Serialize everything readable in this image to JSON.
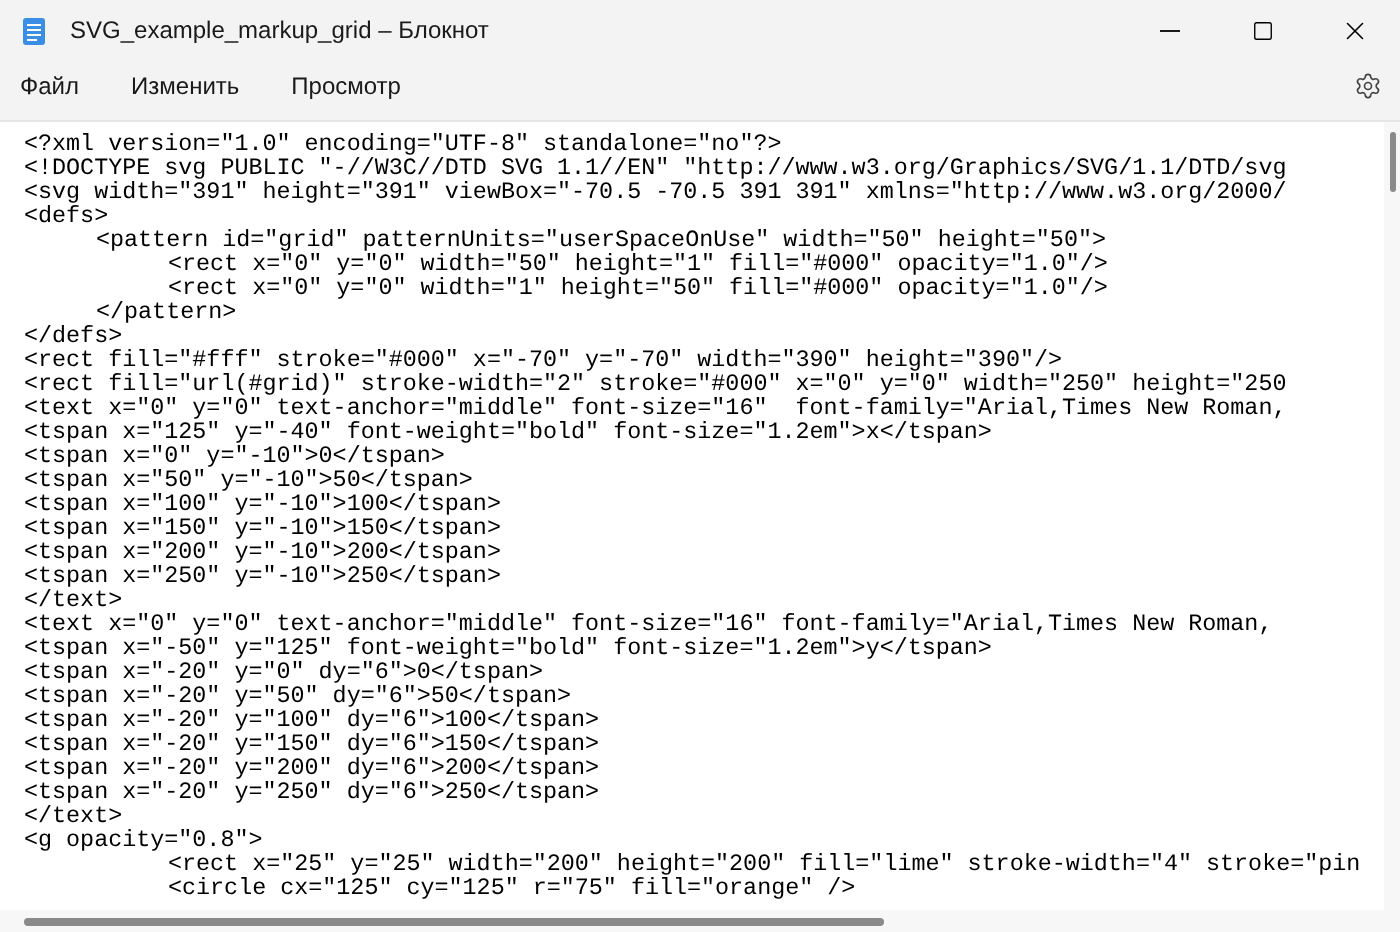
{
  "window": {
    "title": "SVG_example_markup_grid – Блокнот"
  },
  "menu": [
    "Файл",
    "Изменить",
    "Просмотр"
  ],
  "editor": {
    "lines": [
      "<?xml version=\"1.0\" encoding=\"UTF-8\" standalone=\"no\"?>",
      "<!DOCTYPE svg PUBLIC \"-//W3C//DTD SVG 1.1//EN\" \"http://www.w3.org/Graphics/SVG/1.1/DTD/svg",
      "<svg width=\"391\" height=\"391\" viewBox=\"-70.5 -70.5 391 391\" xmlns=\"http://www.w3.org/2000/",
      "<defs>",
      "\t<pattern id=\"grid\" patternUnits=\"userSpaceOnUse\" width=\"50\" height=\"50\">",
      "\t\t<rect x=\"0\" y=\"0\" width=\"50\" height=\"1\" fill=\"#000\" opacity=\"1.0\"/>",
      "\t\t<rect x=\"0\" y=\"0\" width=\"1\" height=\"50\" fill=\"#000\" opacity=\"1.0\"/>",
      "\t</pattern>",
      "</defs>",
      "<rect fill=\"#fff\" stroke=\"#000\" x=\"-70\" y=\"-70\" width=\"390\" height=\"390\"/>",
      "<rect fill=\"url(#grid)\" stroke-width=\"2\" stroke=\"#000\" x=\"0\" y=\"0\" width=\"250\" height=\"250",
      "<text x=\"0\" y=\"0\" text-anchor=\"middle\" font-size=\"16\"  font-family=\"Arial,Times New Roman,",
      "<tspan x=\"125\" y=\"-40\" font-weight=\"bold\" font-size=\"1.2em\">x</tspan>",
      "<tspan x=\"0\" y=\"-10\">0</tspan>",
      "<tspan x=\"50\" y=\"-10\">50</tspan>",
      "<tspan x=\"100\" y=\"-10\">100</tspan>",
      "<tspan x=\"150\" y=\"-10\">150</tspan>",
      "<tspan x=\"200\" y=\"-10\">200</tspan>",
      "<tspan x=\"250\" y=\"-10\">250</tspan>",
      "</text>",
      "<text x=\"0\" y=\"0\" text-anchor=\"middle\" font-size=\"16\" font-family=\"Arial,Times New Roman,",
      "<tspan x=\"-50\" y=\"125\" font-weight=\"bold\" font-size=\"1.2em\">y</tspan>",
      "<tspan x=\"-20\" y=\"0\" dy=\"6\">0</tspan>",
      "<tspan x=\"-20\" y=\"50\" dy=\"6\">50</tspan>",
      "<tspan x=\"-20\" y=\"100\" dy=\"6\">100</tspan>",
      "<tspan x=\"-20\" y=\"150\" dy=\"6\">150</tspan>",
      "<tspan x=\"-20\" y=\"200\" dy=\"6\">200</tspan>",
      "<tspan x=\"-20\" y=\"250\" dy=\"6\">250</tspan>",
      "</text>",
      "<g opacity=\"0.8\">",
      "\t\t<rect x=\"25\" y=\"25\" width=\"200\" height=\"200\" fill=\"lime\" stroke-width=\"4\" stroke=\"pin",
      "\t\t<circle cx=\"125\" cy=\"125\" r=\"75\" fill=\"orange\" />"
    ]
  }
}
